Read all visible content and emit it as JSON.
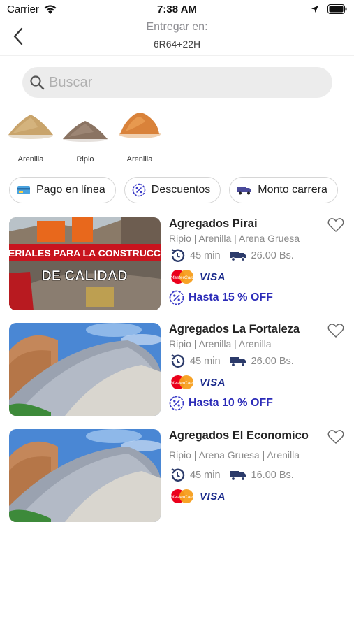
{
  "status_bar": {
    "carrier": "Carrier",
    "time": "7:38 AM"
  },
  "header": {
    "deliver_label": "Entregar en:",
    "address": "6R64+22H"
  },
  "search": {
    "placeholder": "Buscar",
    "value": ""
  },
  "categories": [
    {
      "label": "Arenilla",
      "color": "#c9a46b"
    },
    {
      "label": "Ripio",
      "color": "#8a7362"
    },
    {
      "label": "Arenilla",
      "color": "#d9823a"
    }
  ],
  "filters": [
    {
      "label": "Pago en línea",
      "icon": "card-icon"
    },
    {
      "label": "Descuentos",
      "icon": "percent-badge-icon"
    },
    {
      "label": "Monto carrera",
      "icon": "delivery-truck-icon"
    }
  ],
  "stores": [
    {
      "name": "Agregados Pirai",
      "categories": "Ripio | Arenilla | Arena Gruesa",
      "time": "45 min",
      "delivery_cost": "26.00 Bs.",
      "card1": "MasterCard",
      "card2": "VISA",
      "discount": "Hasta 15 % OFF",
      "banner_text_top": "ERIALES PARA LA CONSTRUCC",
      "banner_text_bottom": "DE CALIDAD"
    },
    {
      "name": "Agregados La Fortaleza",
      "categories": "Ripio | Arenilla | Arenilla",
      "time": "45 min",
      "delivery_cost": "26.00 Bs.",
      "card1": "MasterCard",
      "card2": "VISA",
      "discount": "Hasta 10 % OFF"
    },
    {
      "name": "Agregados El Economico",
      "categories": "Ripio | Arena Gruesa | Arenilla",
      "time": "45 min",
      "delivery_cost": "16.00 Bs.",
      "card1": "MasterCard",
      "card2": "VISA"
    }
  ],
  "colors": {
    "accent_blue": "#2b2bb8",
    "muted_gray": "#8a8a8a",
    "mastercard_red": "#eb001b",
    "mastercard_orange": "#f79e1b"
  }
}
